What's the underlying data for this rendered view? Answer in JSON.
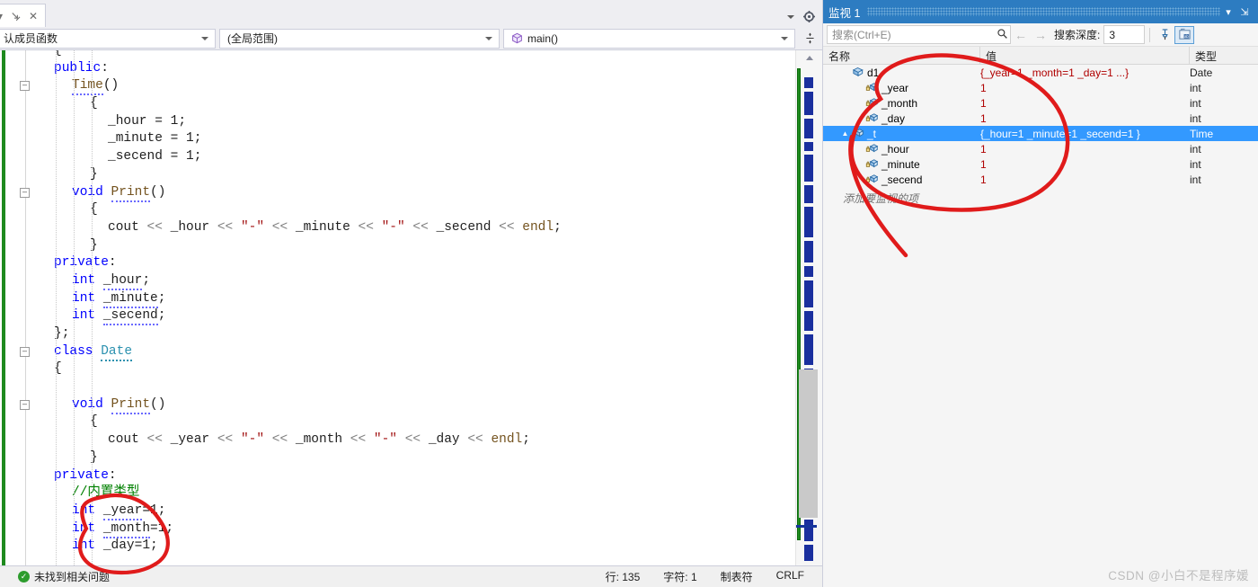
{
  "editor": {
    "tab": {
      "pin_icon": "pin-icon",
      "close_icon": "close-icon",
      "overflow_icon": "chevron-down-icon",
      "settings_icon": "gear-icon"
    },
    "navbar": {
      "members_combo": "认成员函数",
      "scope_combo": "(全局范围)",
      "function_combo": "main()",
      "split_icon": "split-window-icon"
    },
    "code_lines": [
      {
        "indent": 1,
        "fold": "none",
        "tokens": [
          {
            "t": "{",
            "c": "op"
          }
        ]
      },
      {
        "indent": 1,
        "fold": "none",
        "tokens": [
          {
            "t": "public",
            "c": "kw"
          },
          {
            "t": ":",
            "c": "op"
          }
        ]
      },
      {
        "indent": 2,
        "fold": "minus",
        "tokens": [
          {
            "t": "Time",
            "c": "fn squig"
          },
          {
            "t": "()",
            "c": "op"
          }
        ]
      },
      {
        "indent": 3,
        "fold": "none",
        "tokens": [
          {
            "t": "{",
            "c": "op"
          }
        ]
      },
      {
        "indent": 4,
        "fold": "none",
        "tokens": [
          {
            "t": "_hour = 1;",
            "c": "op"
          }
        ]
      },
      {
        "indent": 4,
        "fold": "none",
        "tokens": [
          {
            "t": "_minute = 1;",
            "c": "op"
          }
        ]
      },
      {
        "indent": 4,
        "fold": "none",
        "tokens": [
          {
            "t": "_secend = 1;",
            "c": "op"
          }
        ]
      },
      {
        "indent": 3,
        "fold": "none",
        "tokens": [
          {
            "t": "}",
            "c": "op"
          }
        ]
      },
      {
        "indent": 2,
        "fold": "minus",
        "tokens": [
          {
            "t": "void",
            "c": "kw"
          },
          {
            "t": " ",
            "c": "op"
          },
          {
            "t": "Print",
            "c": "fn squig"
          },
          {
            "t": "()",
            "c": "op"
          }
        ]
      },
      {
        "indent": 3,
        "fold": "none",
        "tokens": [
          {
            "t": "{",
            "c": "op"
          }
        ]
      },
      {
        "indent": 4,
        "fold": "none",
        "tokens": [
          {
            "t": "cout ",
            "c": "op"
          },
          {
            "t": "<< ",
            "c": "pp"
          },
          {
            "t": "_hour ",
            "c": "op"
          },
          {
            "t": "<< ",
            "c": "pp"
          },
          {
            "t": "\"-\"",
            "c": "str"
          },
          {
            "t": " ",
            "c": "op"
          },
          {
            "t": "<< ",
            "c": "pp"
          },
          {
            "t": "_minute ",
            "c": "op"
          },
          {
            "t": "<< ",
            "c": "pp"
          },
          {
            "t": "\"-\"",
            "c": "str"
          },
          {
            "t": " ",
            "c": "op"
          },
          {
            "t": "<< ",
            "c": "pp"
          },
          {
            "t": "_secend ",
            "c": "op"
          },
          {
            "t": "<< ",
            "c": "pp"
          },
          {
            "t": "endl",
            "c": "fn"
          },
          {
            "t": ";",
            "c": "op"
          }
        ]
      },
      {
        "indent": 3,
        "fold": "none",
        "tokens": [
          {
            "t": "}",
            "c": "op"
          }
        ]
      },
      {
        "indent": 1,
        "fold": "none",
        "tokens": [
          {
            "t": "private",
            "c": "kw"
          },
          {
            "t": ":",
            "c": "op"
          }
        ]
      },
      {
        "indent": 2,
        "fold": "none",
        "tokens": [
          {
            "t": "int",
            "c": "kw"
          },
          {
            "t": " ",
            "c": "op"
          },
          {
            "t": "_hour",
            "c": "op squig"
          },
          {
            "t": ";",
            "c": "op"
          }
        ]
      },
      {
        "indent": 2,
        "fold": "none",
        "tokens": [
          {
            "t": "int",
            "c": "kw"
          },
          {
            "t": " ",
            "c": "op"
          },
          {
            "t": "_minute",
            "c": "op squig"
          },
          {
            "t": ";",
            "c": "op"
          }
        ]
      },
      {
        "indent": 2,
        "fold": "none",
        "tokens": [
          {
            "t": "int",
            "c": "kw"
          },
          {
            "t": " ",
            "c": "op"
          },
          {
            "t": "_secend",
            "c": "op squig"
          },
          {
            "t": ";",
            "c": "op"
          }
        ]
      },
      {
        "indent": 1,
        "fold": "none",
        "tokens": [
          {
            "t": "};",
            "c": "op"
          }
        ]
      },
      {
        "indent": 1,
        "fold": "minus",
        "tokens": [
          {
            "t": "class",
            "c": "kw"
          },
          {
            "t": " ",
            "c": "op"
          },
          {
            "t": "Date",
            "c": "type squig-g"
          }
        ]
      },
      {
        "indent": 1,
        "fold": "none",
        "tokens": [
          {
            "t": "{",
            "c": "op"
          }
        ]
      },
      {
        "indent": 1,
        "fold": "none",
        "tokens": []
      },
      {
        "indent": 2,
        "fold": "minus",
        "tokens": [
          {
            "t": "void",
            "c": "kw"
          },
          {
            "t": " ",
            "c": "op"
          },
          {
            "t": "Print",
            "c": "fn squig"
          },
          {
            "t": "()",
            "c": "op"
          }
        ]
      },
      {
        "indent": 3,
        "fold": "none",
        "tokens": [
          {
            "t": "{",
            "c": "op"
          }
        ]
      },
      {
        "indent": 4,
        "fold": "none",
        "tokens": [
          {
            "t": "cout ",
            "c": "op"
          },
          {
            "t": "<< ",
            "c": "pp"
          },
          {
            "t": "_year ",
            "c": "op"
          },
          {
            "t": "<< ",
            "c": "pp"
          },
          {
            "t": "\"-\"",
            "c": "str"
          },
          {
            "t": " ",
            "c": "op"
          },
          {
            "t": "<< ",
            "c": "pp"
          },
          {
            "t": "_month ",
            "c": "op"
          },
          {
            "t": "<< ",
            "c": "pp"
          },
          {
            "t": "\"-\"",
            "c": "str"
          },
          {
            "t": " ",
            "c": "op"
          },
          {
            "t": "<< ",
            "c": "pp"
          },
          {
            "t": "_day ",
            "c": "op"
          },
          {
            "t": "<< ",
            "c": "pp"
          },
          {
            "t": "endl",
            "c": "fn"
          },
          {
            "t": ";",
            "c": "op"
          }
        ]
      },
      {
        "indent": 3,
        "fold": "none",
        "tokens": [
          {
            "t": "}",
            "c": "op"
          }
        ]
      },
      {
        "indent": 1,
        "fold": "none",
        "tokens": [
          {
            "t": "private",
            "c": "kw"
          },
          {
            "t": ":",
            "c": "op"
          }
        ]
      },
      {
        "indent": 2,
        "fold": "none",
        "tokens": [
          {
            "t": "//内置类型",
            "c": "cmt"
          }
        ]
      },
      {
        "indent": 2,
        "fold": "none",
        "tokens": [
          {
            "t": "int",
            "c": "kw"
          },
          {
            "t": " ",
            "c": "op"
          },
          {
            "t": "_year",
            "c": "op squig"
          },
          {
            "t": "=1;",
            "c": "op"
          }
        ]
      },
      {
        "indent": 2,
        "fold": "none",
        "tokens": [
          {
            "t": "int",
            "c": "kw"
          },
          {
            "t": " ",
            "c": "op"
          },
          {
            "t": "_month",
            "c": "op squig"
          },
          {
            "t": "=1;",
            "c": "op"
          }
        ]
      },
      {
        "indent": 2,
        "fold": "none",
        "tokens": [
          {
            "t": "int",
            "c": "kw"
          },
          {
            "t": " ",
            "c": "op"
          },
          {
            "t": "_day",
            "c": "op"
          },
          {
            "t": "=1;",
            "c": "op"
          }
        ]
      }
    ],
    "statusbar": {
      "issue_icon": "check-circle-icon",
      "issue_text": "未找到相关问题",
      "line": "行: 135",
      "column": "字符: 1",
      "tabs": "制表符",
      "eol": "CRLF"
    }
  },
  "watch": {
    "title": "监视 1",
    "title_dropdown_icon": "chevron-down-icon",
    "title_pin_icon": "pin-icon",
    "toolbar": {
      "search_placeholder": "搜索(Ctrl+E)",
      "search_icon": "search-icon",
      "search_dropdown_icon": "chevron-down-icon",
      "back_icon": "arrow-left-icon",
      "forward_icon": "arrow-right-icon",
      "depth_label": "搜索深度:",
      "depth_value": "3",
      "depth_dropdown_icon": "chevron-down-icon",
      "pin_button_icon": "pin-toolbar-icon",
      "hex_button_icon": "hex-display-icon"
    },
    "columns": {
      "name": "名称",
      "value": "值",
      "type": "类型"
    },
    "rows": [
      {
        "indent": 0,
        "expander": "",
        "icon": "struct-icon",
        "name": "d1",
        "value": "{_year=1 _month=1 _day=1 ...}",
        "type": "Date",
        "selected": false
      },
      {
        "indent": 1,
        "expander": "",
        "icon": "field-icon",
        "name": "_year",
        "value": "1",
        "type": "int",
        "selected": false
      },
      {
        "indent": 1,
        "expander": "",
        "icon": "field-icon",
        "name": "_month",
        "value": "1",
        "type": "int",
        "selected": false
      },
      {
        "indent": 1,
        "expander": "",
        "icon": "field-icon",
        "name": "_day",
        "value": "1",
        "type": "int",
        "selected": false
      },
      {
        "indent": 0,
        "expander": "▲",
        "icon": "field-icon",
        "name": "_t",
        "value": "{_hour=1 _minute=1 _secend=1 }",
        "type": "Time",
        "selected": true
      },
      {
        "indent": 1,
        "expander": "",
        "icon": "field-icon",
        "name": "_hour",
        "value": "1",
        "type": "int",
        "selected": false
      },
      {
        "indent": 1,
        "expander": "",
        "icon": "field-icon",
        "name": "_minute",
        "value": "1",
        "type": "int",
        "selected": false
      },
      {
        "indent": 1,
        "expander": "",
        "icon": "field-icon",
        "name": "_secend",
        "value": "1",
        "type": "int",
        "selected": false
      }
    ],
    "add_item_text": "添加要监视的项"
  },
  "watermark": "CSDN @小白不是程序媛",
  "annotations": {
    "ink_color": "#e01b1b",
    "shapes": [
      "watch-panel-circle",
      "code-members-circle"
    ]
  }
}
